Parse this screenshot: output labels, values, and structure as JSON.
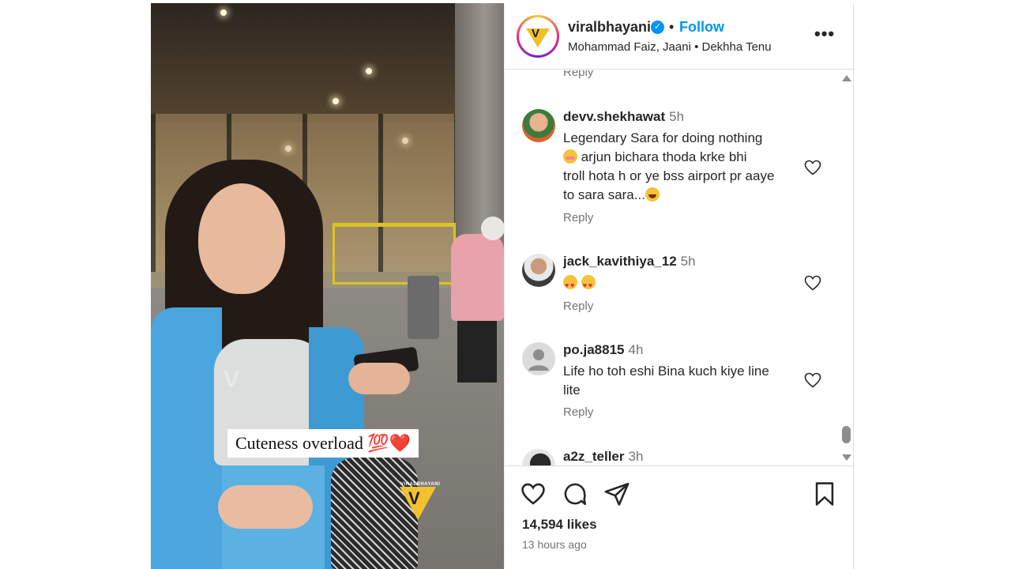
{
  "post": {
    "username": "viralbhayani",
    "follow_label": "Follow",
    "separator": "•",
    "music": "Mohammad Faiz, Jaani • Dekhha Tenu",
    "more_label": "•••"
  },
  "media": {
    "caption_text": "Cuteness overload 💯❤️",
    "watermark_text": "VIRALBHAYANI"
  },
  "comments": {
    "top_reply_label": "Reply",
    "items": [
      {
        "user": "devv.shekhawat",
        "time": "5h",
        "line1": "Legendary Sara for doing nothing",
        "line2": " arjun bichara thoda krke bhi",
        "line3": "troll hota h or ye bss airport pr aaye",
        "line4": "to sara sara...",
        "reply": "Reply"
      },
      {
        "user": "jack_kavithiya_12",
        "time": "5h",
        "reply": "Reply"
      },
      {
        "user": "po.ja8815",
        "time": "4h",
        "line1": "Life ho toh eshi Bina kuch kiye line",
        "line2": "lite",
        "reply": "Reply"
      },
      {
        "user": "a2z_teller",
        "time": "3h"
      }
    ]
  },
  "footer": {
    "likes": "14,594 likes",
    "time_ago": "13 hours ago"
  },
  "colors": {
    "follow_blue": "#0095f6",
    "verified_blue": "#0095f6",
    "secondary_text": "#737373",
    "primary_text": "#262626",
    "border": "#dbdbdb"
  },
  "icons": [
    "verified-badge-icon",
    "more-options-icon",
    "heart-icon",
    "comment-icon",
    "share-icon",
    "bookmark-icon",
    "scroll-up-icon",
    "scroll-down-icon"
  ]
}
